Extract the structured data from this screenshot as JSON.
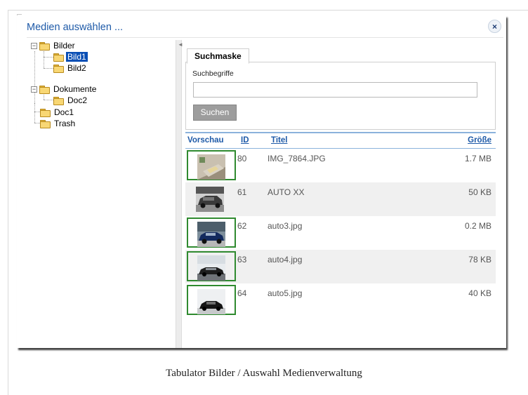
{
  "dialog": {
    "title": "Medien auswählen ...",
    "close_label": "×"
  },
  "tree": {
    "items": [
      {
        "label": "Bilder",
        "expander": "−",
        "selected": false
      },
      {
        "label": "Bild1",
        "selected": true
      },
      {
        "label": "Bild2",
        "selected": false
      },
      {
        "label": "Dokumente",
        "expander": "−",
        "selected": false
      },
      {
        "label": "Doc2",
        "selected": false
      },
      {
        "label": "Doc1",
        "selected": false
      },
      {
        "label": "Trash",
        "selected": false
      }
    ]
  },
  "splitter": {
    "arrow": "◄"
  },
  "search": {
    "tab_label": "Suchmaske",
    "field_label": "Suchbegriffe",
    "input_value": "",
    "button_label": "Suchen"
  },
  "results": {
    "headers": {
      "preview": "Vorschau",
      "id": "ID",
      "title": "Titel",
      "size": "Größe"
    },
    "rows": [
      {
        "id": "80",
        "title": "IMG_7864.JPG",
        "size": "1.7 MB",
        "selected": true,
        "thumb": "thumb-dish"
      },
      {
        "id": "61",
        "title": "AUTO XX",
        "size": "50 KB",
        "selected": false,
        "thumb": "thumb-car-gray"
      },
      {
        "id": "62",
        "title": "auto3.jpg",
        "size": "0.2 MB",
        "selected": true,
        "thumb": "thumb-car-blue"
      },
      {
        "id": "63",
        "title": "auto4.jpg",
        "size": "78 KB",
        "selected": true,
        "thumb": "thumb-car-street"
      },
      {
        "id": "64",
        "title": "auto5.jpg",
        "size": "40 KB",
        "selected": true,
        "thumb": "thumb-car-black"
      }
    ]
  },
  "caption": "Tabulator Bilder / Auswahl Medienverwaltung",
  "colors": {
    "title_blue": "#1e5aa8",
    "selection_blue": "#0a4fb5",
    "thumb_border_green": "#2f8a2f",
    "header_line_blue": "#8bb2dc"
  }
}
